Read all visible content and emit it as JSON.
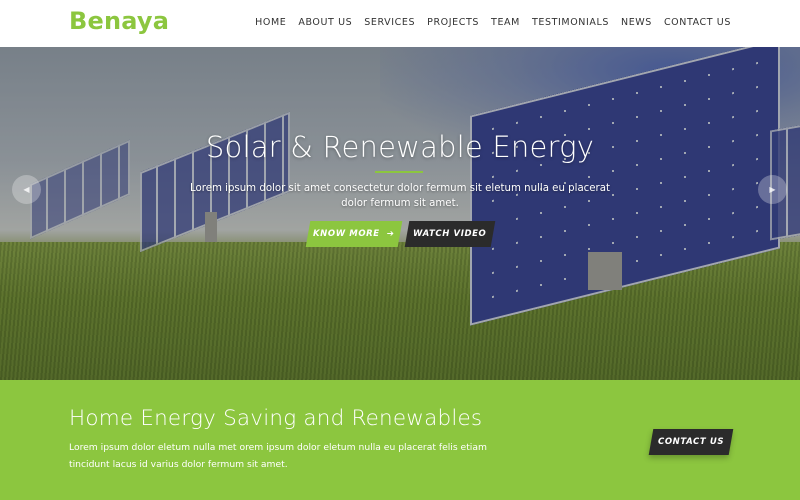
{
  "header": {
    "logo": "Benaya",
    "nav": [
      {
        "label": "HOME"
      },
      {
        "label": "ABOUT US"
      },
      {
        "label": "SERVICES"
      },
      {
        "label": "PROJECTS"
      },
      {
        "label": "TEAM"
      },
      {
        "label": "TESTIMONIALS"
      },
      {
        "label": "NEWS"
      },
      {
        "label": "CONTACT US"
      }
    ]
  },
  "hero": {
    "title": "Solar & Renewable Energy",
    "text": "Lorem ipsum dolor sit amet consectetur dolor fermum sit eletum nulla eu placerat dolor fermum sit amet.",
    "primary_button": "KNOW MORE",
    "primary_icon": "arrow-right-icon",
    "secondary_button": "WATCH VIDEO",
    "prev_icon": "chevron-left-icon",
    "next_icon": "chevron-right-icon"
  },
  "band": {
    "title": "Home Energy Saving and Renewables",
    "text": "Lorem ipsum dolor eletum nulla met orem ipsum dolor eletum nulla eu placerat felis etiam tincidunt lacus id varius dolor fermum sit amet.",
    "button": "CONTACT US"
  },
  "colors": {
    "brand": "#8cc63f",
    "dark_button": "#2b2b2b"
  }
}
